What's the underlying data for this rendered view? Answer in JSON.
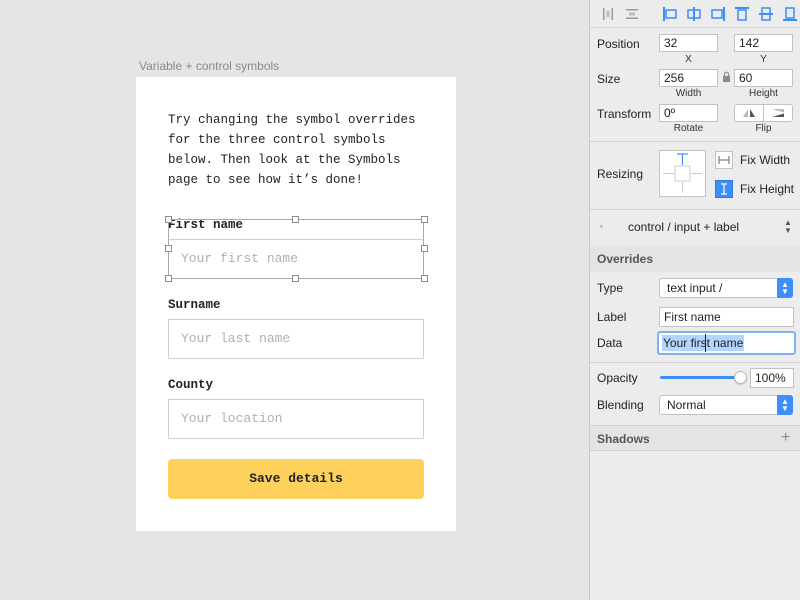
{
  "canvas": {
    "artboard_label": "Variable + control symbols",
    "intro_text": "Try changing the symbol overrides\nfor the three control symbols\nbelow. Then look at the Symbols\npage to see how it’s done!",
    "fields": [
      {
        "label": "First name",
        "placeholder": "Your first name"
      },
      {
        "label": "Surname",
        "placeholder": "Your last name"
      },
      {
        "label": "County",
        "placeholder": "Your location"
      }
    ],
    "button_label": "Save details"
  },
  "inspector": {
    "position": {
      "label": "Position",
      "x": "32",
      "y": "142",
      "x_label": "X",
      "y_label": "Y"
    },
    "size": {
      "label": "Size",
      "width": "256",
      "height": "60",
      "width_label": "Width",
      "height_label": "Height"
    },
    "transform": {
      "label": "Transform",
      "rotate": "0º",
      "rotate_label": "Rotate",
      "flip_label": "Flip"
    },
    "resizing": {
      "label": "Resizing",
      "fix_width": "Fix Width",
      "fix_height": "Fix Height"
    },
    "symbol": "control / input + label",
    "overrides": {
      "header": "Overrides",
      "type_label": "Type",
      "type_value": "text input /",
      "label_label": "Label",
      "label_value": "First name",
      "data_label": "Data",
      "data_value": "Your first name"
    },
    "opacity": {
      "label": "Opacity",
      "value": "100%",
      "level": 1.0
    },
    "blending": {
      "label": "Blending",
      "value": "Normal"
    },
    "shadows": {
      "label": "Shadows"
    }
  },
  "colors": {
    "accent": "#3d8ef8",
    "button": "#fed15d"
  }
}
